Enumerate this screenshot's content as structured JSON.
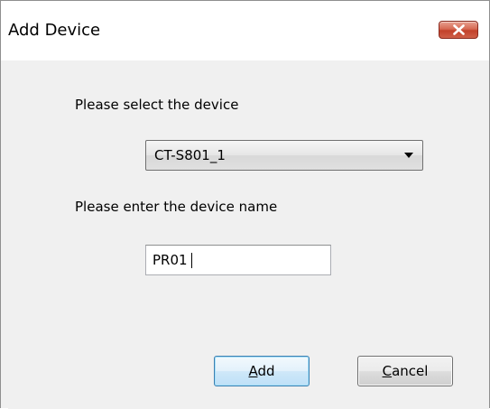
{
  "window": {
    "title": "Add Device",
    "close_icon": "close-icon"
  },
  "form": {
    "select_label": "Please select the device",
    "selected_device": "CT-S801_1",
    "name_label": "Please enter the device name",
    "device_name_value": "PR01"
  },
  "buttons": {
    "add": {
      "mnemonic": "A",
      "rest": "dd"
    },
    "cancel": {
      "mnemonic": "C",
      "rest": "ancel"
    }
  },
  "colors": {
    "close_button": "#c74a33",
    "default_button_border": "#3c7fb1"
  }
}
